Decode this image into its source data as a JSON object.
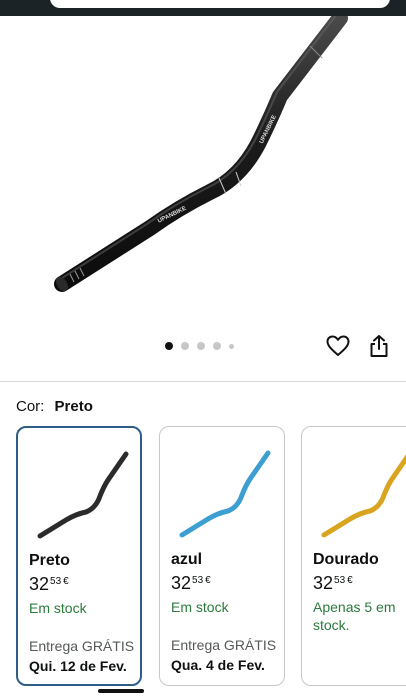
{
  "gallery": {
    "dot_count": 5,
    "active_dot": 0
  },
  "color_selector": {
    "label": "Cor:",
    "selected": "Preto"
  },
  "variants": [
    {
      "name": "Preto",
      "price_whole": "32",
      "price_cents": "53",
      "currency": "€",
      "stock": "Em stock",
      "delivery": "Entrega GRÁTIS",
      "date": "Qui. 12 de Fev.",
      "color": "#2b2b2b",
      "selected": true
    },
    {
      "name": "azul",
      "price_whole": "32",
      "price_cents": "53",
      "currency": "€",
      "stock": "Em stock",
      "delivery": "Entrega GRÁTIS",
      "date": "Qua. 4 de Fev.",
      "color": "#3d9fd1",
      "selected": false
    },
    {
      "name": "Dourado",
      "price_whole": "32",
      "price_cents": "53",
      "currency": "€",
      "stock": "Apenas 5 em stock.",
      "delivery": "",
      "date": "",
      "color": "#d9a520",
      "selected": false
    }
  ],
  "icons": {
    "favorite": "heart-outline-icon",
    "share": "share-icon"
  }
}
